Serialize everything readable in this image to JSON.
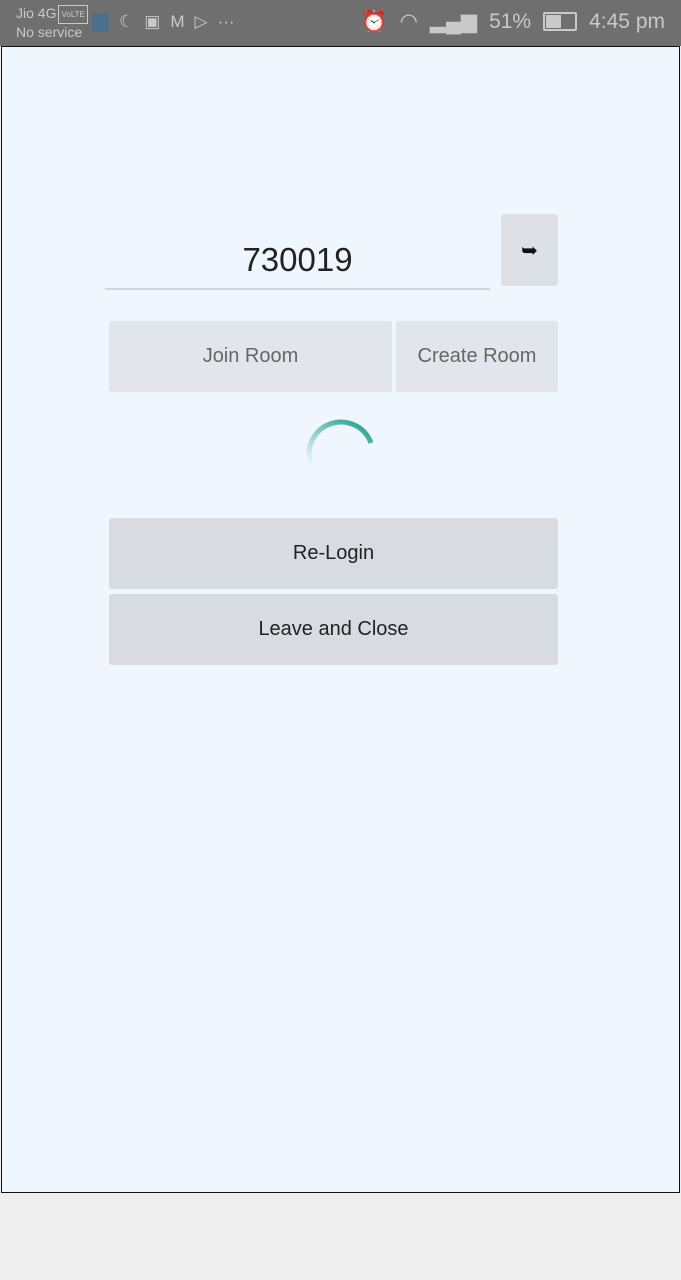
{
  "status_bar": {
    "carrier": "Jio 4G",
    "volte_badge": "VoLTE",
    "service": "No service",
    "battery": "51%",
    "battery_level": 0.51,
    "time": "4:45 pm",
    "icons": [
      "shield-icon",
      "missed-call-icon",
      "youtube-icon",
      "gmail-icon",
      "play-store-icon",
      "more-icon",
      "alarm-icon",
      "wifi-icon",
      "signal-icon",
      "no-signal-icon",
      "battery-icon"
    ]
  },
  "room": {
    "code_value": "730019",
    "go_icon": "arrow-right-icon",
    "join_label": "Join Room",
    "create_label": "Create Room",
    "spinner_color": "#1a9a8a"
  },
  "actions": {
    "relogin_label": "Re-Login",
    "leave_label": "Leave and Close"
  }
}
